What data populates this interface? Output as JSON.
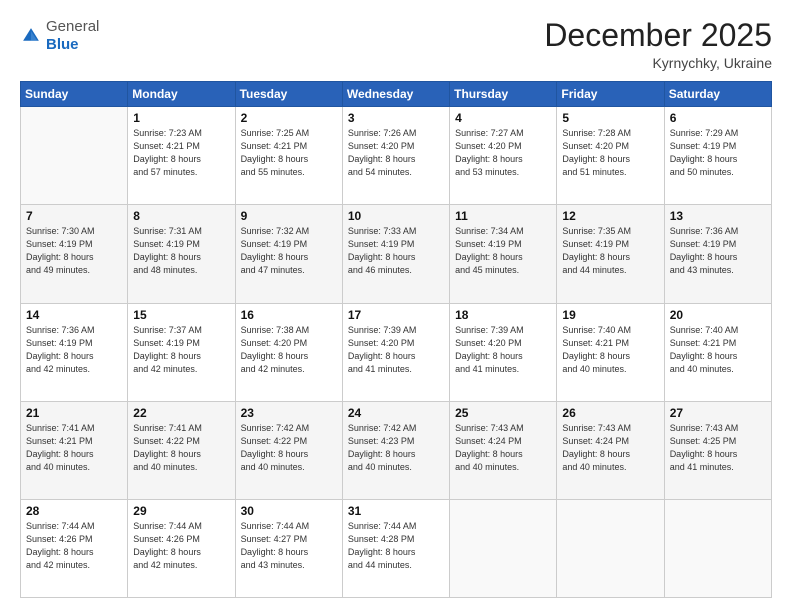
{
  "logo": {
    "general": "General",
    "blue": "Blue"
  },
  "header": {
    "month": "December 2025",
    "location": "Kyrnychky, Ukraine"
  },
  "weekdays": [
    "Sunday",
    "Monday",
    "Tuesday",
    "Wednesday",
    "Thursday",
    "Friday",
    "Saturday"
  ],
  "weeks": [
    [
      {
        "day": "",
        "info": ""
      },
      {
        "day": "1",
        "info": "Sunrise: 7:23 AM\nSunset: 4:21 PM\nDaylight: 8 hours\nand 57 minutes."
      },
      {
        "day": "2",
        "info": "Sunrise: 7:25 AM\nSunset: 4:21 PM\nDaylight: 8 hours\nand 55 minutes."
      },
      {
        "day": "3",
        "info": "Sunrise: 7:26 AM\nSunset: 4:20 PM\nDaylight: 8 hours\nand 54 minutes."
      },
      {
        "day": "4",
        "info": "Sunrise: 7:27 AM\nSunset: 4:20 PM\nDaylight: 8 hours\nand 53 minutes."
      },
      {
        "day": "5",
        "info": "Sunrise: 7:28 AM\nSunset: 4:20 PM\nDaylight: 8 hours\nand 51 minutes."
      },
      {
        "day": "6",
        "info": "Sunrise: 7:29 AM\nSunset: 4:19 PM\nDaylight: 8 hours\nand 50 minutes."
      }
    ],
    [
      {
        "day": "7",
        "info": "Sunrise: 7:30 AM\nSunset: 4:19 PM\nDaylight: 8 hours\nand 49 minutes."
      },
      {
        "day": "8",
        "info": "Sunrise: 7:31 AM\nSunset: 4:19 PM\nDaylight: 8 hours\nand 48 minutes."
      },
      {
        "day": "9",
        "info": "Sunrise: 7:32 AM\nSunset: 4:19 PM\nDaylight: 8 hours\nand 47 minutes."
      },
      {
        "day": "10",
        "info": "Sunrise: 7:33 AM\nSunset: 4:19 PM\nDaylight: 8 hours\nand 46 minutes."
      },
      {
        "day": "11",
        "info": "Sunrise: 7:34 AM\nSunset: 4:19 PM\nDaylight: 8 hours\nand 45 minutes."
      },
      {
        "day": "12",
        "info": "Sunrise: 7:35 AM\nSunset: 4:19 PM\nDaylight: 8 hours\nand 44 minutes."
      },
      {
        "day": "13",
        "info": "Sunrise: 7:36 AM\nSunset: 4:19 PM\nDaylight: 8 hours\nand 43 minutes."
      }
    ],
    [
      {
        "day": "14",
        "info": "Sunrise: 7:36 AM\nSunset: 4:19 PM\nDaylight: 8 hours\nand 42 minutes."
      },
      {
        "day": "15",
        "info": "Sunrise: 7:37 AM\nSunset: 4:19 PM\nDaylight: 8 hours\nand 42 minutes."
      },
      {
        "day": "16",
        "info": "Sunrise: 7:38 AM\nSunset: 4:20 PM\nDaylight: 8 hours\nand 42 minutes."
      },
      {
        "day": "17",
        "info": "Sunrise: 7:39 AM\nSunset: 4:20 PM\nDaylight: 8 hours\nand 41 minutes."
      },
      {
        "day": "18",
        "info": "Sunrise: 7:39 AM\nSunset: 4:20 PM\nDaylight: 8 hours\nand 41 minutes."
      },
      {
        "day": "19",
        "info": "Sunrise: 7:40 AM\nSunset: 4:21 PM\nDaylight: 8 hours\nand 40 minutes."
      },
      {
        "day": "20",
        "info": "Sunrise: 7:40 AM\nSunset: 4:21 PM\nDaylight: 8 hours\nand 40 minutes."
      }
    ],
    [
      {
        "day": "21",
        "info": "Sunrise: 7:41 AM\nSunset: 4:21 PM\nDaylight: 8 hours\nand 40 minutes."
      },
      {
        "day": "22",
        "info": "Sunrise: 7:41 AM\nSunset: 4:22 PM\nDaylight: 8 hours\nand 40 minutes."
      },
      {
        "day": "23",
        "info": "Sunrise: 7:42 AM\nSunset: 4:22 PM\nDaylight: 8 hours\nand 40 minutes."
      },
      {
        "day": "24",
        "info": "Sunrise: 7:42 AM\nSunset: 4:23 PM\nDaylight: 8 hours\nand 40 minutes."
      },
      {
        "day": "25",
        "info": "Sunrise: 7:43 AM\nSunset: 4:24 PM\nDaylight: 8 hours\nand 40 minutes."
      },
      {
        "day": "26",
        "info": "Sunrise: 7:43 AM\nSunset: 4:24 PM\nDaylight: 8 hours\nand 40 minutes."
      },
      {
        "day": "27",
        "info": "Sunrise: 7:43 AM\nSunset: 4:25 PM\nDaylight: 8 hours\nand 41 minutes."
      }
    ],
    [
      {
        "day": "28",
        "info": "Sunrise: 7:44 AM\nSunset: 4:26 PM\nDaylight: 8 hours\nand 42 minutes."
      },
      {
        "day": "29",
        "info": "Sunrise: 7:44 AM\nSunset: 4:26 PM\nDaylight: 8 hours\nand 42 minutes."
      },
      {
        "day": "30",
        "info": "Sunrise: 7:44 AM\nSunset: 4:27 PM\nDaylight: 8 hours\nand 43 minutes."
      },
      {
        "day": "31",
        "info": "Sunrise: 7:44 AM\nSunset: 4:28 PM\nDaylight: 8 hours\nand 44 minutes."
      },
      {
        "day": "",
        "info": ""
      },
      {
        "day": "",
        "info": ""
      },
      {
        "day": "",
        "info": ""
      }
    ]
  ]
}
